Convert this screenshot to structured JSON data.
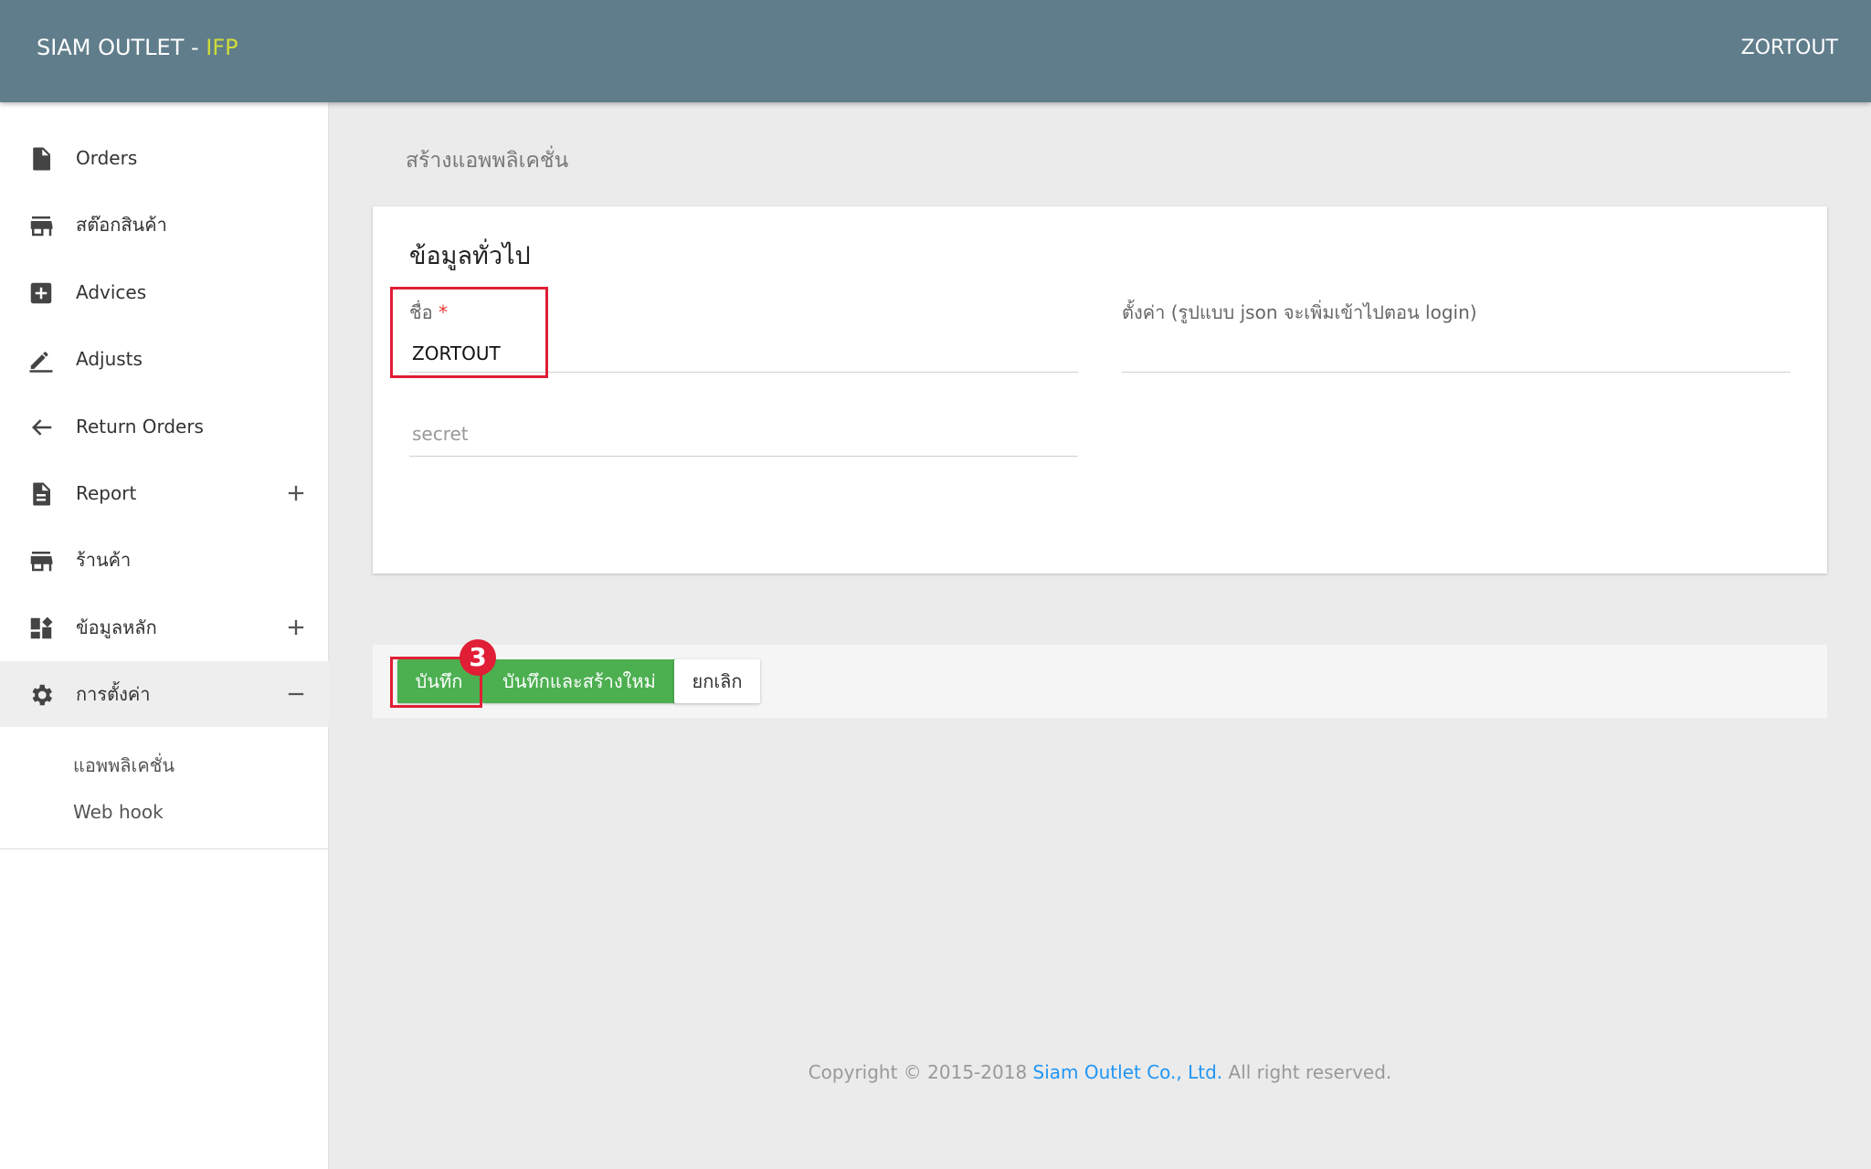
{
  "header": {
    "brand_main": "SIAM OUTLET - ",
    "brand_accent": "IFP",
    "user_name": "ZORTOUT"
  },
  "sidebar": {
    "items": [
      {
        "label": "Orders",
        "icon": "document-icon"
      },
      {
        "label": "สต๊อกสินค้า",
        "icon": "store-icon"
      },
      {
        "label": "Advices",
        "icon": "add-box-icon"
      },
      {
        "label": "Adjusts",
        "icon": "pencil-icon"
      },
      {
        "label": "Return Orders",
        "icon": "return-arrow-icon"
      },
      {
        "label": "Report",
        "icon": "report-icon",
        "expandable": true
      },
      {
        "label": "ร้านค้า",
        "icon": "store-icon"
      },
      {
        "label": "ข้อมูลหลัก",
        "icon": "dashboard-icon",
        "expandable": true
      },
      {
        "label": "การตั้งค่า",
        "icon": "gear-icon",
        "expanded": true,
        "active": true
      }
    ],
    "sub_items": [
      {
        "label": "แอพพลิเคชั่น"
      },
      {
        "label": "Web hook"
      }
    ]
  },
  "page": {
    "title": "สร้างแอพพลิเคชั่น"
  },
  "form": {
    "section_title": "ข้อมูลทั่วไป",
    "name_label": "ชื่อ",
    "name_required_mark": "*",
    "name_value": "ZORTOUT",
    "settings_label": "ตั้งค่า (รูปแบบ json จะเพิ่มเข้าไปตอน login)",
    "settings_value": "",
    "secret_placeholder": "secret",
    "secret_value": ""
  },
  "actions": {
    "save_label": "บันทึก",
    "save_new_label": "บันทึกและสร้างใหม่",
    "cancel_label": "ยกเลิก"
  },
  "annotation": {
    "step_number": "3"
  },
  "footer": {
    "prefix": "Copyright © 2015-2018 ",
    "company": "Siam Outlet Co., Ltd.",
    "suffix": " All right reserved."
  },
  "colors": {
    "topbar": "#607d8b",
    "brand_accent": "#cddc39",
    "primary_button": "#4caf50",
    "annotation": "#e01e35",
    "link": "#2196f3"
  }
}
